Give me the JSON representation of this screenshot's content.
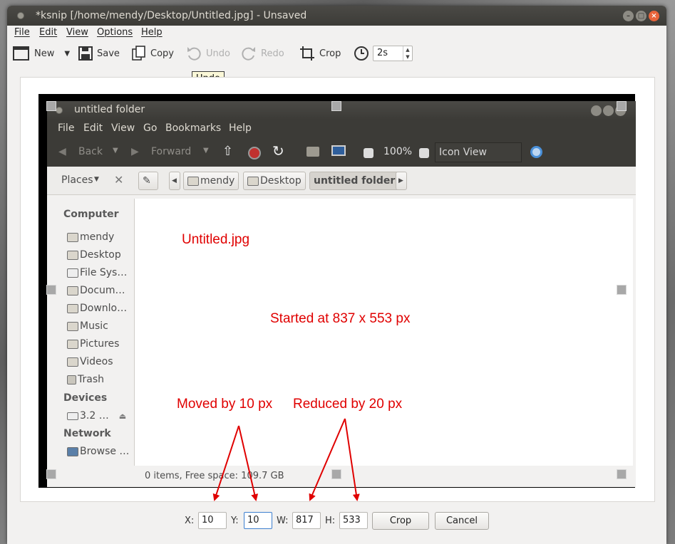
{
  "window": {
    "title": "*ksnip [/home/mendy/Desktop/Untitled.jpg] - Unsaved",
    "controls": [
      "minimize",
      "maximize",
      "close"
    ]
  },
  "menubar": [
    "File",
    "Edit",
    "View",
    "Options",
    "Help"
  ],
  "toolbar": {
    "new_label": "New",
    "save_label": "Save",
    "copy_label": "Copy",
    "undo_label": "Undo",
    "redo_label": "Redo",
    "crop_label": "Crop",
    "delay_value": "2s"
  },
  "tooltip": "Undo",
  "captured": {
    "title": "untitled folder",
    "menu": [
      "File",
      "Edit",
      "View",
      "Go",
      "Bookmarks",
      "Help"
    ],
    "toolbar": {
      "back": "Back",
      "forward": "Forward",
      "zoom": "100%",
      "view_mode": "Icon View"
    },
    "places_label": "Places",
    "breadcrumbs": [
      "mendy",
      "Desktop",
      "untitled folder"
    ],
    "sidebar": {
      "computer_heading": "Computer",
      "computer_items": [
        "mendy",
        "Desktop",
        "File Sys…",
        "Docum…",
        "Downlo…",
        "Music",
        "Pictures",
        "Videos",
        "Trash"
      ],
      "devices_heading": "Devices",
      "devices_items": [
        "3.2 …"
      ],
      "network_heading": "Network",
      "network_items": [
        "Browse …"
      ]
    },
    "status": "0 items, Free space: 109.7 GB"
  },
  "annotations": {
    "filename": "Untitled.jpg",
    "started": "Started at 837 x 553 px",
    "moved": "Moved by 10 px",
    "reduced": "Reduced by 20 px",
    "color": "#e00000"
  },
  "crop_bar": {
    "x_label": "X:",
    "x_value": "10",
    "y_label": "Y:",
    "y_value": "10",
    "w_label": "W:",
    "w_value": "817",
    "h_label": "H:",
    "h_value": "533",
    "crop_button": "Crop",
    "cancel_button": "Cancel"
  }
}
